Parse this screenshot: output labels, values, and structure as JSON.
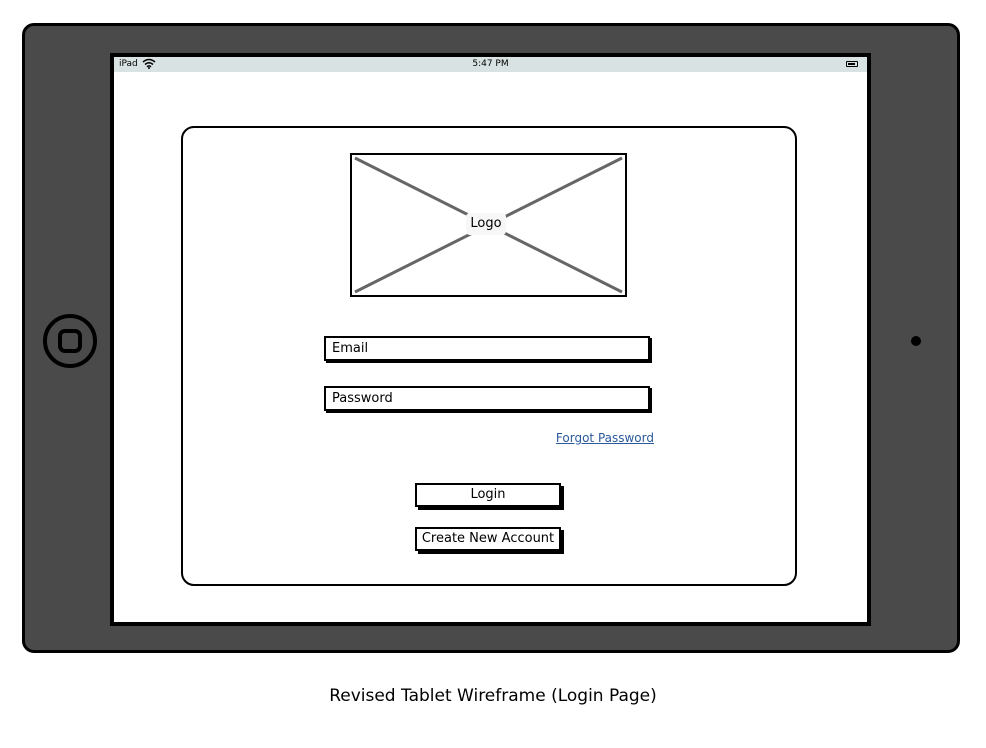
{
  "status_bar": {
    "carrier": "iPad",
    "wifi_icon": "wifi-icon",
    "time": "5:47 PM",
    "battery_icon": "battery-icon"
  },
  "login_card": {
    "logo_label": "Logo",
    "email_placeholder": "Email",
    "password_placeholder": "Password",
    "forgot_password_link": "Forgot Password",
    "login_button": "Login",
    "create_account_button": "Create New Account"
  },
  "caption": "Revised Tablet Wireframe (Login Page)",
  "colors": {
    "tablet_frame": "#4a4a4a",
    "status_bar": "#d9e2e2",
    "link": "#2b5a9c"
  }
}
